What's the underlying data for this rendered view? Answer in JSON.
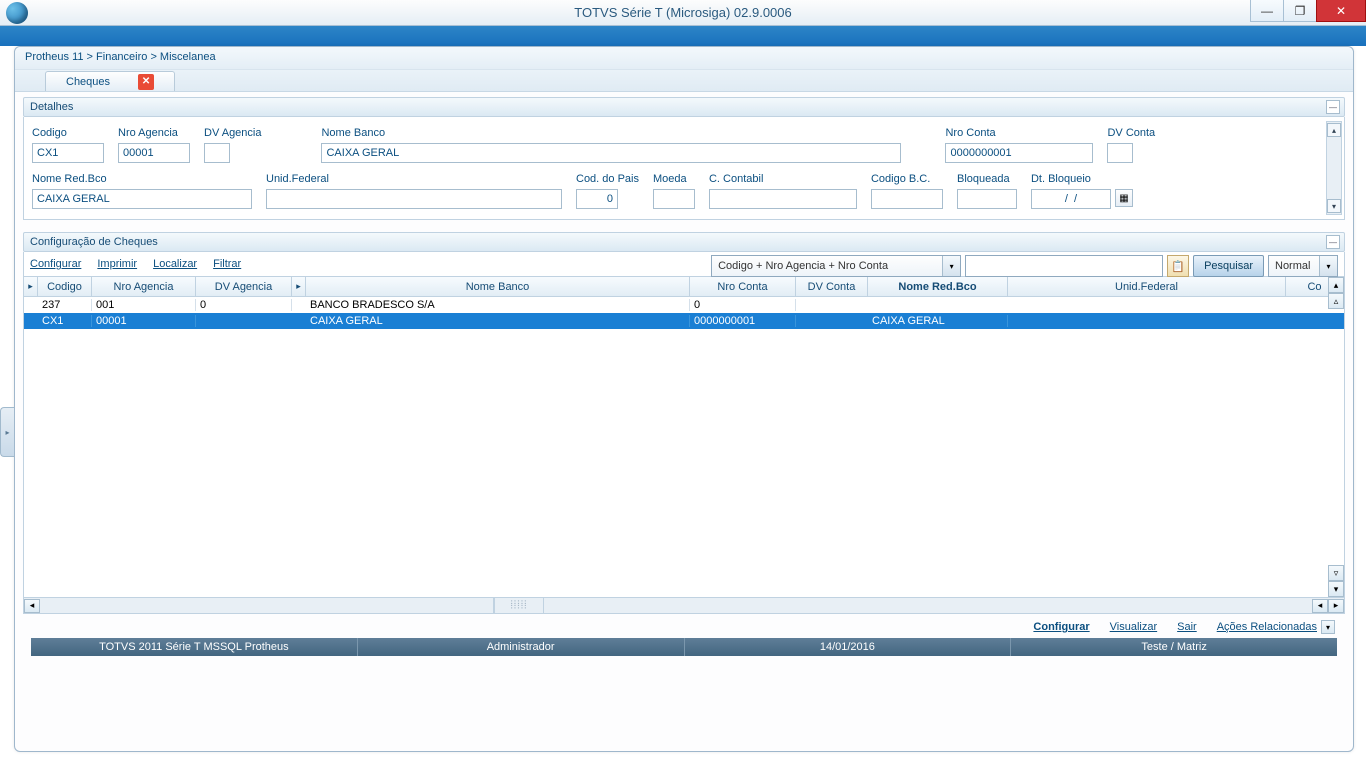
{
  "window": {
    "title": "TOTVS Série T  (Microsiga) 02.9.0006"
  },
  "breadcrumb": "Protheus 11 > Financeiro > Miscelanea",
  "tab": {
    "label": "Cheques"
  },
  "sections": {
    "detalhes": "Detalhes",
    "config": "Configuração de Cheques"
  },
  "fields": {
    "codigo": {
      "label": "Codigo",
      "value": "CX1"
    },
    "nroAgencia": {
      "label": "Nro Agencia",
      "value": "00001"
    },
    "dvAgencia": {
      "label": "DV Agencia",
      "value": ""
    },
    "nomeBanco": {
      "label": "Nome Banco",
      "value": "CAIXA GERAL"
    },
    "nroConta": {
      "label": "Nro Conta",
      "value": "0000000001"
    },
    "dvConta": {
      "label": "DV Conta",
      "value": ""
    },
    "nomeRedBco": {
      "label": "Nome Red.Bco",
      "value": "CAIXA GERAL"
    },
    "unidFederal": {
      "label": "Unid.Federal",
      "value": ""
    },
    "codPais": {
      "label": "Cod. do Pais",
      "value": "0"
    },
    "moeda": {
      "label": "Moeda",
      "value": ""
    },
    "cContabil": {
      "label": "C. Contabil",
      "value": ""
    },
    "codigoBC": {
      "label": "Codigo B.C.",
      "value": ""
    },
    "bloqueada": {
      "label": "Bloqueada",
      "value": ""
    },
    "dtBloqueio": {
      "label": "Dt. Bloqueio",
      "value": "/  /"
    }
  },
  "links": {
    "configurar": "Configurar",
    "imprimir": "Imprimir",
    "localizar": "Localizar",
    "filtrar": "Filtrar"
  },
  "search": {
    "index": "Codigo + Nro Agencia + Nro Conta",
    "value": "",
    "button": "Pesquisar",
    "mode": "Normal"
  },
  "grid": {
    "headers": {
      "codigo": "Codigo",
      "nroAgencia": "Nro Agencia",
      "dvAgencia": "DV Agencia",
      "nomeBanco": "Nome Banco",
      "nroConta": "Nro Conta",
      "dvConta": "DV Conta",
      "nomeRedBco": "Nome  Red.Bco",
      "unidFederal": "Unid.Federal",
      "extra": "Co"
    },
    "rows": [
      {
        "codigo": "237",
        "nroAgencia": "001",
        "dvAgencia": "0",
        "nomeBanco": "BANCO BRADESCO S/A",
        "nroConta": "0",
        "dvConta": "",
        "nomeRedBco": "",
        "unidFederal": ""
      },
      {
        "codigo": "CX1",
        "nroAgencia": "00001",
        "dvAgencia": "",
        "nomeBanco": "CAIXA GERAL",
        "nroConta": "0000000001",
        "dvConta": "",
        "nomeRedBco": "CAIXA GERAL",
        "unidFederal": ""
      }
    ]
  },
  "actions": {
    "configurar": "Configurar",
    "visualizar": "Visualizar",
    "sair": "Sair",
    "relacionadas": "Ações Relacionadas"
  },
  "status": {
    "app": "TOTVS 2011 Série T  MSSQL Protheus",
    "user": "Administrador",
    "date": "14/01/2016",
    "env": "Teste / Matriz"
  }
}
